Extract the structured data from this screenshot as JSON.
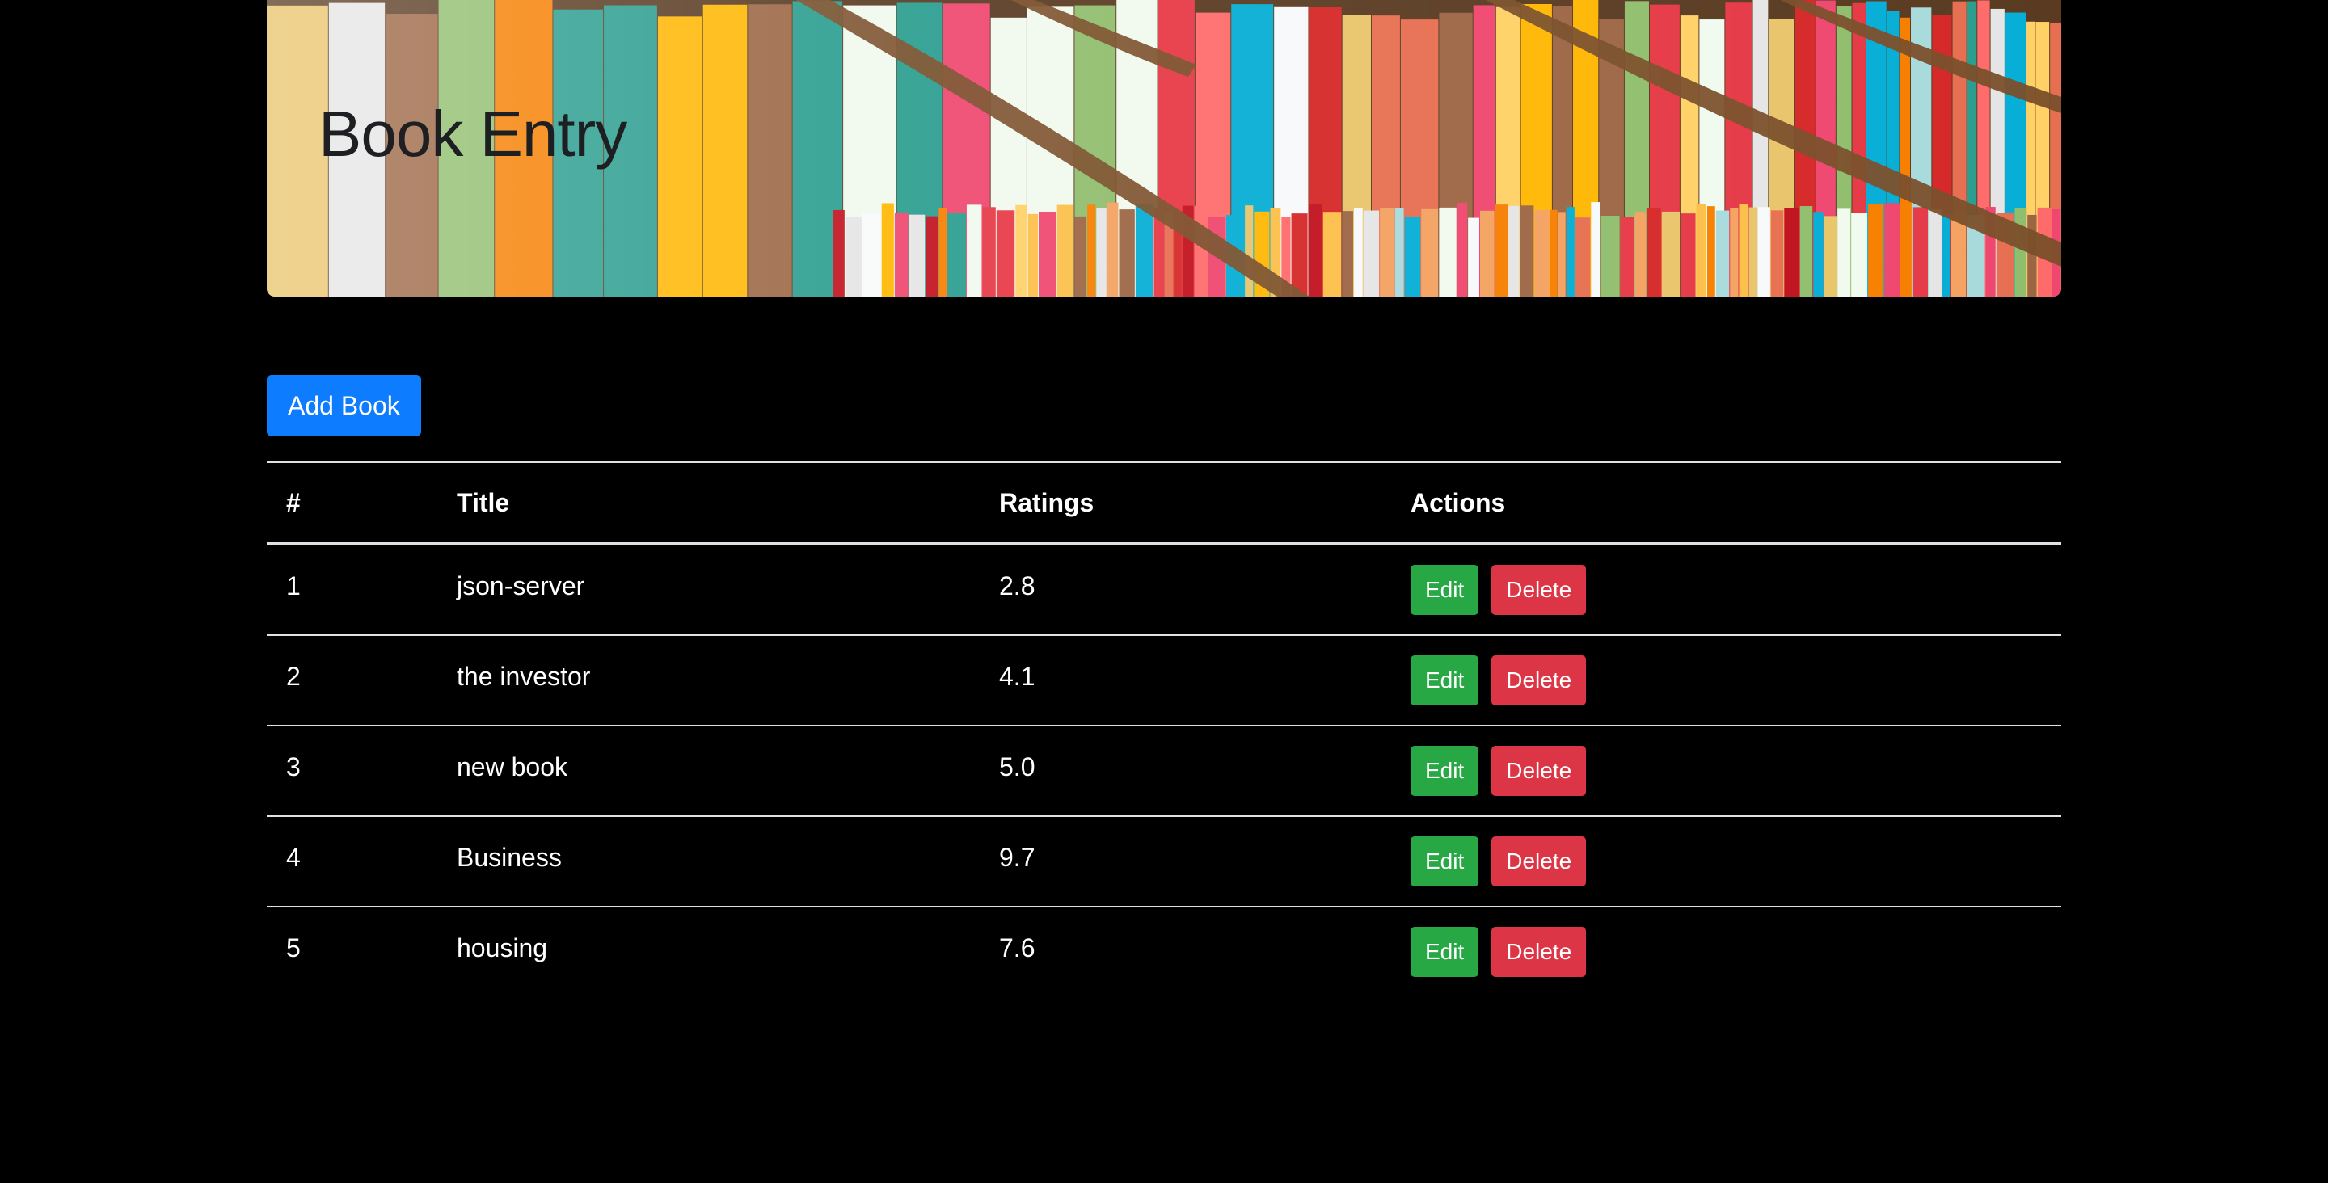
{
  "hero": {
    "title": "Book Entry"
  },
  "toolbar": {
    "add_label": "Add Book"
  },
  "table": {
    "headers": [
      "#",
      "Title",
      "Ratings",
      "Actions"
    ],
    "rows": [
      {
        "num": "1",
        "title": "json-server",
        "rating": "2.8",
        "edit": "Edit",
        "delete": "Delete"
      },
      {
        "num": "2",
        "title": "the investor",
        "rating": "4.1",
        "edit": "Edit",
        "delete": "Delete"
      },
      {
        "num": "3",
        "title": "new book",
        "rating": "5.0",
        "edit": "Edit",
        "delete": "Delete"
      },
      {
        "num": "4",
        "title": "Business",
        "rating": "9.7",
        "edit": "Edit",
        "delete": "Delete"
      },
      {
        "num": "5",
        "title": "housing",
        "rating": "7.6",
        "edit": "Edit",
        "delete": "Delete"
      }
    ]
  },
  "colors": {
    "background": "#000000",
    "primary": "#0d7cff",
    "success": "#28a745",
    "danger": "#dc3545",
    "title_text": "#1d1f22"
  }
}
